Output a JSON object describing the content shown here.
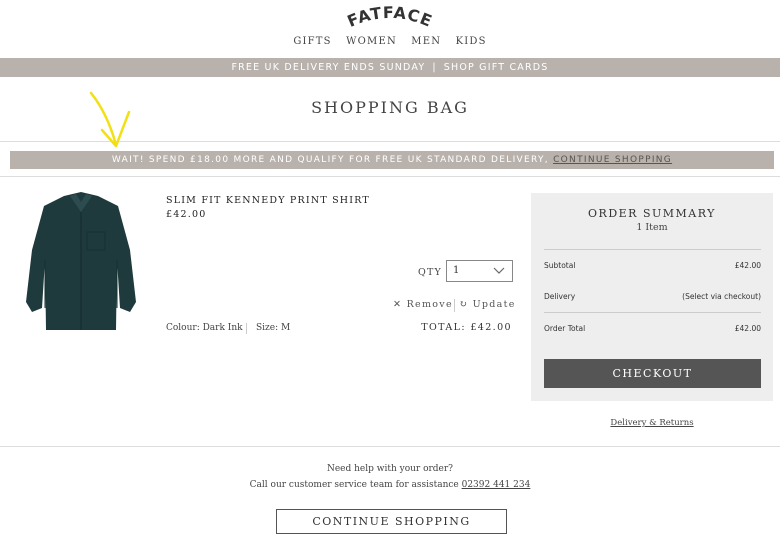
{
  "brand": {
    "logo": "FATFACE"
  },
  "nav": {
    "items": [
      "GIFTS",
      "WOMEN",
      "MEN",
      "KIDS"
    ]
  },
  "promo": {
    "left": "FREE UK DELIVERY ENDS SUNDAY",
    "separator": "|",
    "right": "SHOP GIFT CARDS"
  },
  "page": {
    "title": "SHOPPING BAG"
  },
  "delivery_banner": {
    "text": "WAIT! SPEND £18.00 MORE AND QUALIFY FOR FREE UK STANDARD DELIVERY,",
    "link": "CONTINUE SHOPPING"
  },
  "item": {
    "name": "SLIM FIT KENNEDY PRINT SHIRT",
    "price": "£42.00",
    "qty_label": "QTY",
    "qty_value": "1",
    "remove_label": "Remove",
    "update_label": "Update",
    "colour": "Colour: Dark Ink",
    "size": "Size: M",
    "total": "TOTAL: £42.00"
  },
  "summary": {
    "title": "ORDER SUMMARY",
    "items_count": "1 Item",
    "subtotal_label": "Subtotal",
    "subtotal_value": "£42.00",
    "delivery_label": "Delivery",
    "delivery_value": "(Select via checkout)",
    "order_total_label": "Order Total",
    "order_total_value": "£42.00",
    "checkout_label": "CHECKOUT"
  },
  "links": {
    "delivery_returns": "Delivery & Returns"
  },
  "help": {
    "line1": "Need help with your order?",
    "line2": "Call our customer service team for assistance",
    "phone": "02392 441 234"
  },
  "footer": {
    "continue_label": "CONTINUE SHOPPING"
  },
  "colors": {
    "bar": "#b9b2ac",
    "summary_bg": "#eeeeee",
    "checkout_bg": "#555555",
    "arrow": "#f2e014"
  },
  "icons": {
    "remove": "close-icon",
    "update": "refresh-icon",
    "qty": "chevron-down-icon"
  }
}
